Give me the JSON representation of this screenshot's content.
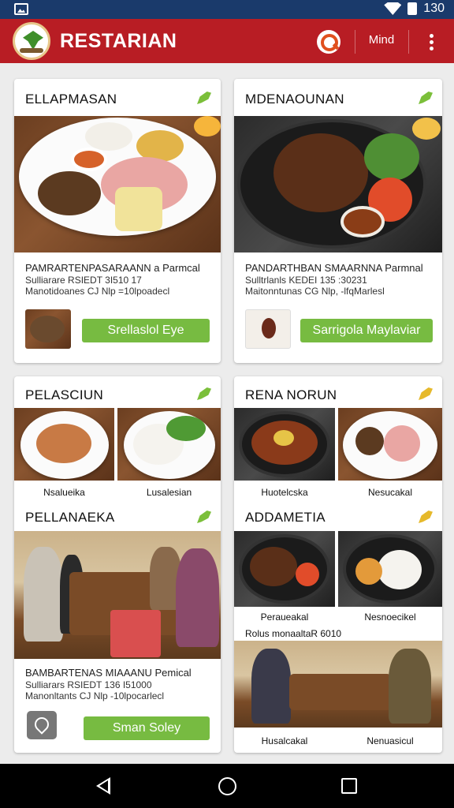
{
  "status_bar": {
    "time": "130"
  },
  "app_bar": {
    "title": "RESTARIAN",
    "mind_label": "Mind"
  },
  "cards": {
    "c1": {
      "title": "ELLAPMASAN",
      "desc_line1": "PAMRARTENPASARAANN a Parmcal",
      "desc_line2": "Sulliarare RSIEDT 3I510 17",
      "desc_line3": "Manotidoanes CJ Nlp =10lpoadecl",
      "button": "Srellaslol Eye"
    },
    "c2": {
      "title": "MDENAOUNAN",
      "desc_line1": "PANDARTHBAN SMAARNNA Parmnal",
      "desc_line2": "Sulltrlanls KEDEI 135 :30231",
      "desc_line3": "Maitonntunas CG Nlp, -lfqMarlesl",
      "button": "Sarrigola Maylaviar"
    },
    "c3": {
      "title": "PELASCIUN",
      "caption_left": "Nsalueika",
      "caption_right": "Lusalesian",
      "section_title": "PELLANAEKA",
      "desc_line1": "BAMBARTENAS MIAAANU Pemical",
      "desc_line2": "Sulliarars RSIEDT 136 I51000",
      "desc_line3": "Manonltants CJ Nlp -10lpocarlecl",
      "button": "Sman Soley"
    },
    "c4": {
      "title": "RENA NORUN",
      "caption_left": "Huotelcska",
      "caption_right": "Nesucakal",
      "section_title": "ADDAMETIA",
      "caption_left2": "Peraueakal",
      "caption_right2": "Nesnoecikel",
      "photo_caption": "Rolus monaaltaR 6010",
      "caption_left3": "Husalcakal",
      "caption_right3": "Nenuasicul"
    }
  },
  "colors": {
    "status_bar": "#1a3a6b",
    "app_bar": "#b81d24",
    "button_green": "#77bb41",
    "background": "#ececec"
  },
  "icons": {
    "logo": "restaurant-leaf-logo",
    "search": "search-icon",
    "overflow": "more-vert-icon",
    "card_badge": "leaf-icon",
    "nav_back": "back-icon",
    "nav_home": "home-icon",
    "nav_recent": "recent-apps-icon"
  }
}
